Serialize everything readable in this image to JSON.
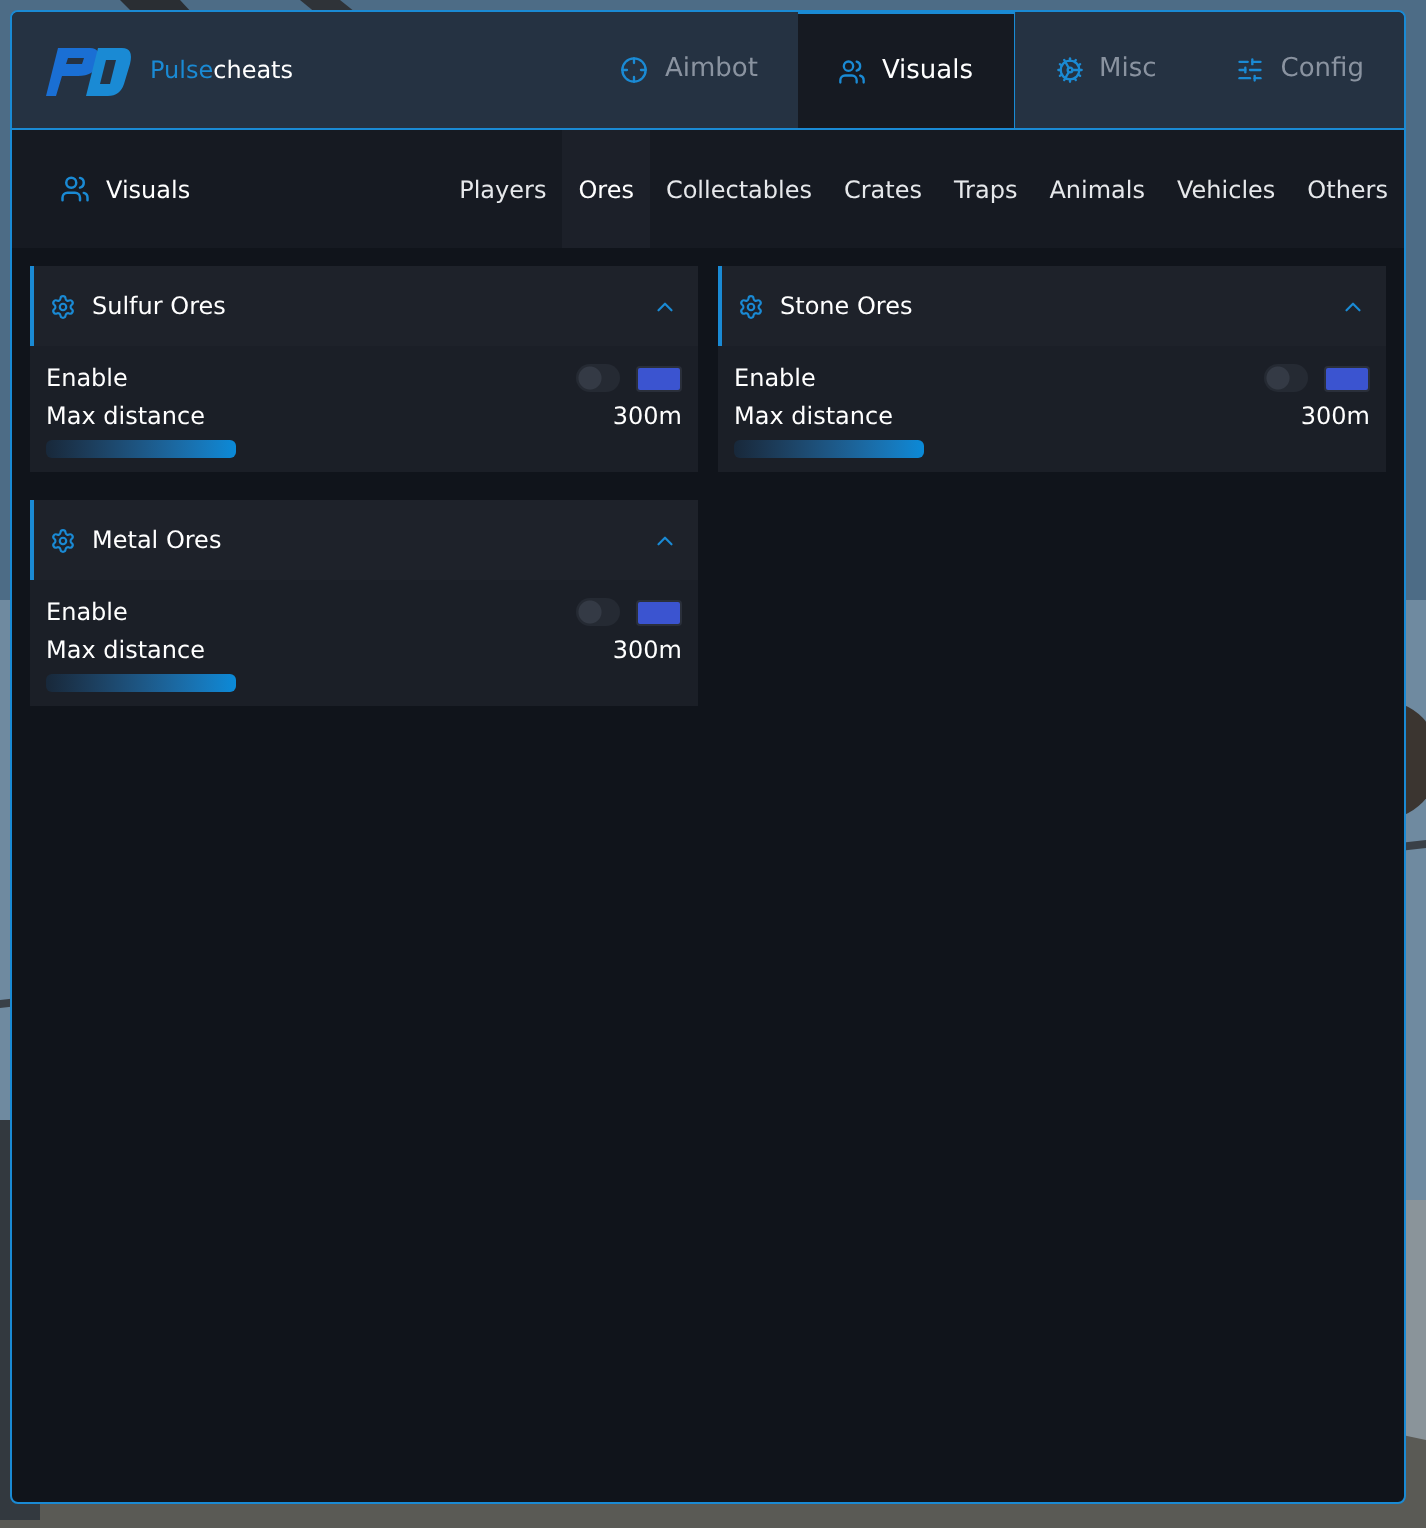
{
  "brand": {
    "first": "Pulse",
    "second": "cheats"
  },
  "tabs": [
    {
      "label": "Aimbot",
      "selected": false
    },
    {
      "label": "Visuals",
      "selected": true
    },
    {
      "label": "Misc",
      "selected": false
    },
    {
      "label": "Config",
      "selected": false
    }
  ],
  "section": {
    "title": "Visuals"
  },
  "subtabs": [
    {
      "label": "Players",
      "selected": false
    },
    {
      "label": "Ores",
      "selected": true
    },
    {
      "label": "Collectables",
      "selected": false
    },
    {
      "label": "Crates",
      "selected": false
    },
    {
      "label": "Traps",
      "selected": false
    },
    {
      "label": "Animals",
      "selected": false
    },
    {
      "label": "Vehicles",
      "selected": false
    },
    {
      "label": "Others",
      "selected": false
    }
  ],
  "cards": [
    {
      "title": "Sulfur Ores",
      "expanded": true,
      "enable": {
        "label": "Enable",
        "on": false,
        "color": "#3b54d0"
      },
      "distance": {
        "label": "Max distance",
        "reading": "300m",
        "level": 0.3
      }
    },
    {
      "title": "Stone Ores",
      "expanded": true,
      "enable": {
        "label": "Enable",
        "on": false,
        "color": "#3b54d0"
      },
      "distance": {
        "label": "Max distance",
        "reading": "300m",
        "level": 0.3
      }
    },
    {
      "title": "Metal Ores",
      "expanded": true,
      "enable": {
        "label": "Enable",
        "on": false,
        "color": "#3b54d0"
      },
      "distance": {
        "label": "Max distance",
        "reading": "300m",
        "level": 0.3
      }
    }
  ]
}
